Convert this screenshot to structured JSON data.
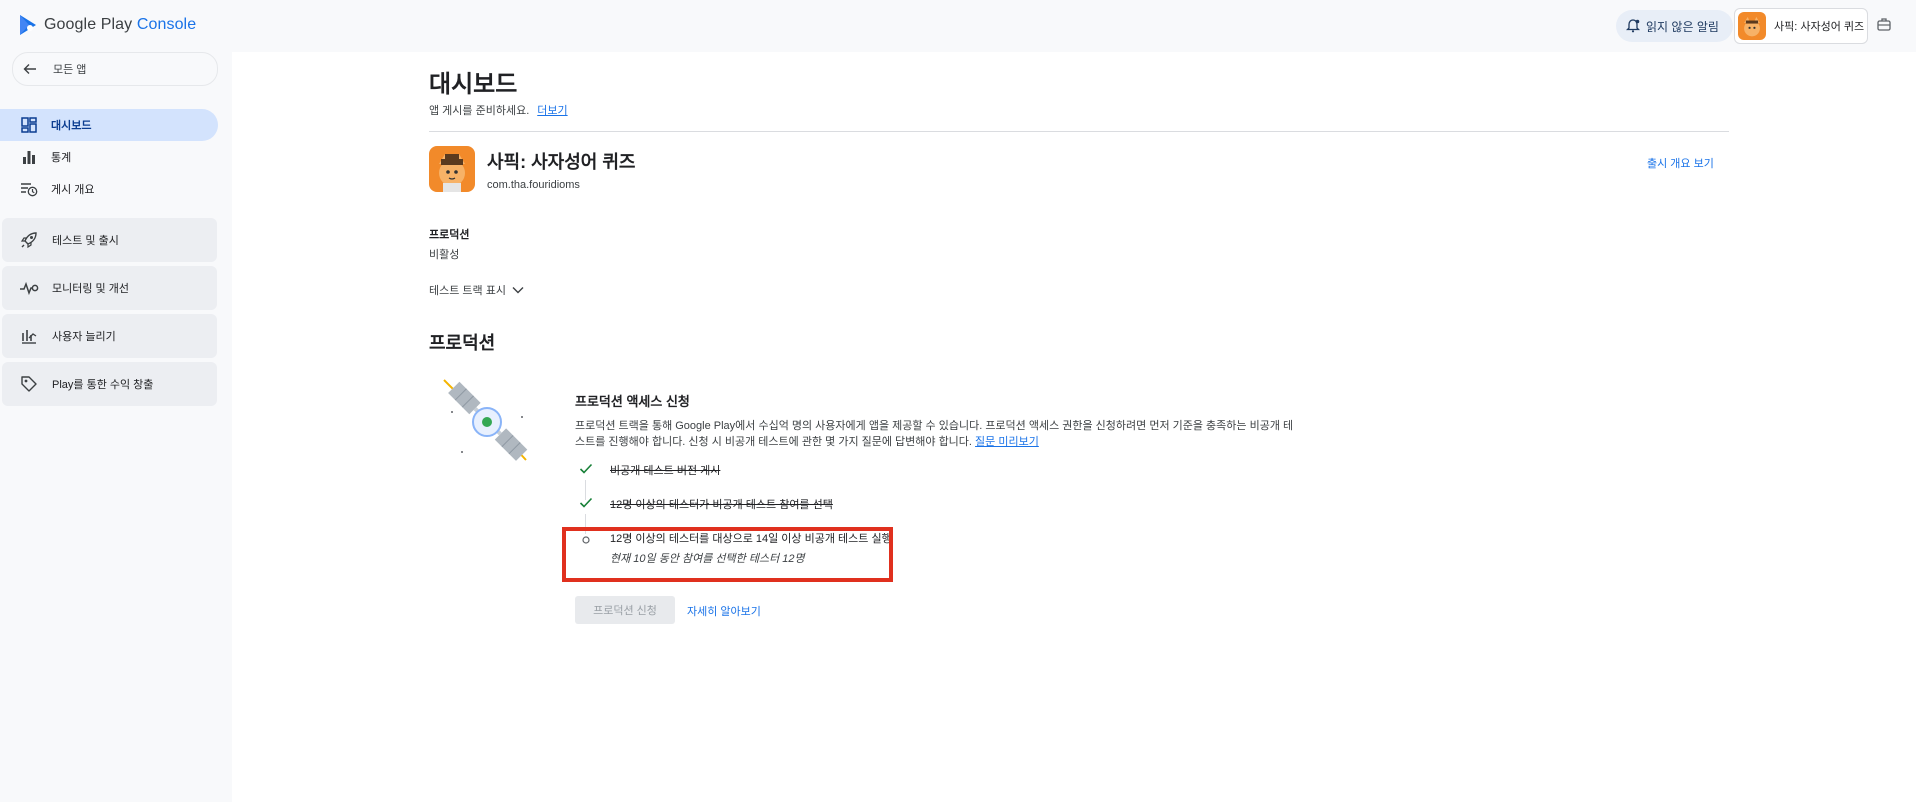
{
  "header": {
    "logo_prefix": "Google Play",
    "logo_accent": "Console",
    "notifications_label": "읽지 않은 알림",
    "app_chip_label": "사픽: 사자성어 퀴즈"
  },
  "sidebar": {
    "back_label": "모든 앱",
    "items": [
      {
        "label": "대시보드",
        "icon": "dashboard-icon",
        "active": true
      },
      {
        "label": "통계",
        "icon": "bar-chart-icon"
      },
      {
        "label": "게시 개요",
        "icon": "publishing-overview-icon"
      }
    ],
    "groups": [
      {
        "label": "테스트 및 출시",
        "icon": "rocket-icon"
      },
      {
        "label": "모니터링 및 개선",
        "icon": "vitals-icon"
      },
      {
        "label": "사용자 늘리기",
        "icon": "grow-users-icon"
      },
      {
        "label": "Play를 통한 수익 창출",
        "icon": "tag-icon"
      }
    ]
  },
  "main": {
    "title": "대시보드",
    "subtitle": "앱 게시를 준비하세요.",
    "subtitle_link": "더보기",
    "app": {
      "name": "사픽: 사자성어 퀴즈",
      "package": "com.tha.fouridioms",
      "release_overview_link": "출시 개요 보기"
    },
    "production": {
      "label": "프로덕션",
      "status": "비활성",
      "show_tracks": "테스트 트랙 표시"
    },
    "section_title": "프로덕션",
    "access_card": {
      "title": "프로덕션 액세스 신청",
      "description": "프로덕션 트랙을 통해 Google Play에서 수십억 명의 사용자에게 앱을 제공할 수 있습니다. 프로덕션 액세스 권한을 신청하려면 먼저 기준을 충족하는 비공개 테스트를 진행해야 합니다. 신청 시 비공개 테스트에 관한 몇 가지 질문에 답변해야 합니다.",
      "preview_link": "질문 미리보기",
      "requirements": [
        {
          "text": "비공개 테스트 버전 게시",
          "done": true
        },
        {
          "text": "12명 이상의 테스터가 비공개 테스트 참여를 선택",
          "done": true
        },
        {
          "text": "12명 이상의 테스터를 대상으로 14일 이상 비공개 테스트 실행",
          "done": false,
          "note": "현재 10일 동안 참여를 선택한 테스터 12명"
        }
      ],
      "apply_button": "프로덕션 신청",
      "learn_more": "자세히 알아보기"
    }
  },
  "colors": {
    "accent": "#1a73e8",
    "active_nav": "#d3e3fd",
    "highlight_box": "#e0301e",
    "check": "#188038"
  }
}
